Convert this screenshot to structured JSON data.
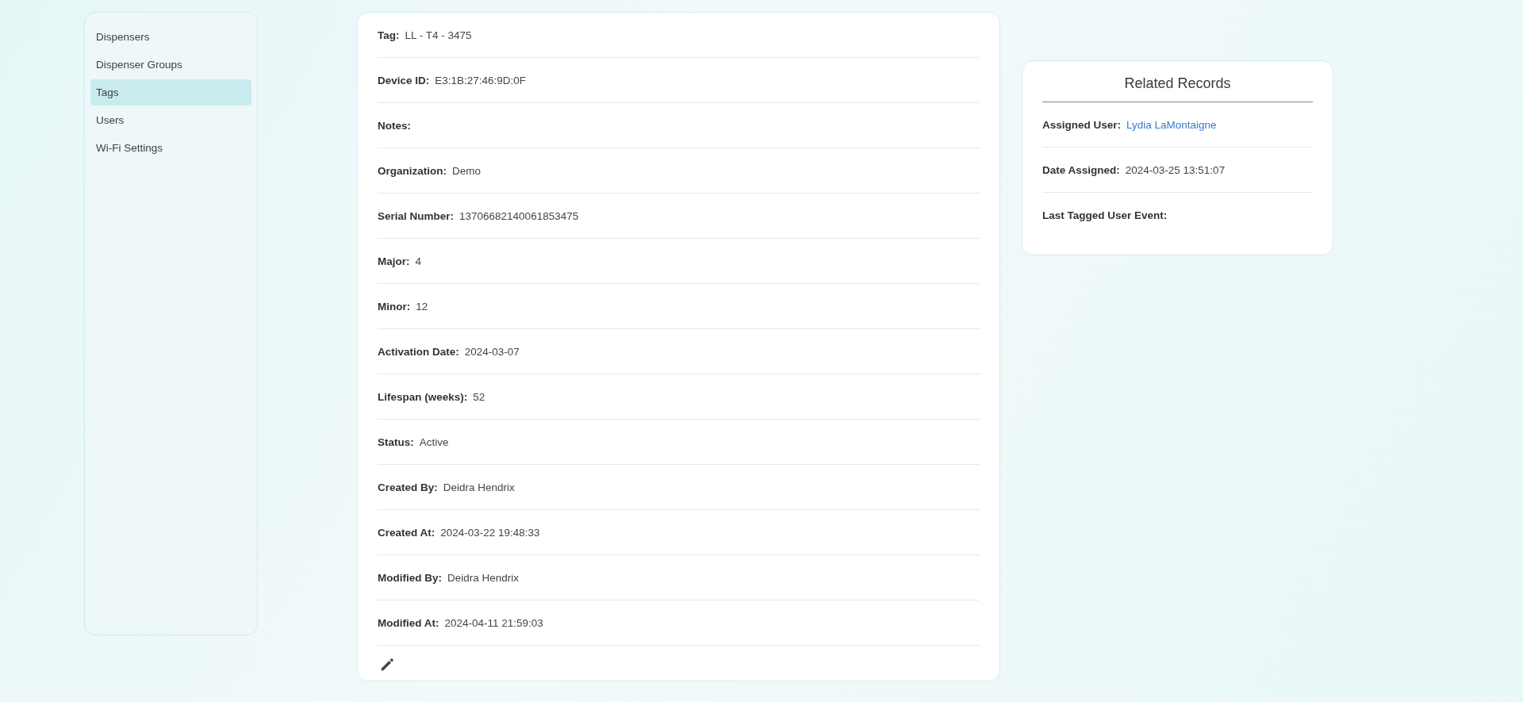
{
  "sidebar": {
    "items": [
      {
        "label": "Dispensers",
        "selected": false
      },
      {
        "label": "Dispenser Groups",
        "selected": false
      },
      {
        "label": "Tags",
        "selected": true
      },
      {
        "label": "Users",
        "selected": false
      },
      {
        "label": "Wi-Fi Settings",
        "selected": false
      }
    ]
  },
  "details": {
    "fields": [
      {
        "label": "Tag:",
        "value": "LL - T4 - 3475"
      },
      {
        "label": "Device ID:",
        "value": "E3:1B:27:46:9D:0F"
      },
      {
        "label": "Notes:"
      },
      {
        "label": "Organization:",
        "value": "Demo"
      },
      {
        "label": "Serial Number:",
        "value": "13706682140061853475"
      },
      {
        "label": "Major:",
        "value": "4"
      },
      {
        "label": "Minor:",
        "value": "12"
      },
      {
        "label": "Activation Date:",
        "value": "2024-03-07"
      },
      {
        "label": "Lifespan (weeks):",
        "value": "52"
      },
      {
        "label": "Status:",
        "value": "Active"
      },
      {
        "label": "Created By:",
        "value": "Deidra Hendrix"
      },
      {
        "label": "Created At:",
        "value": "2024-03-22 19:48:33"
      },
      {
        "label": "Modified By:",
        "value": "Deidra Hendrix"
      },
      {
        "label": "Modified At:",
        "value": "2024-04-11 21:59:03"
      }
    ]
  },
  "related_records": {
    "title": "Related Records",
    "fields": [
      {
        "label": "Assigned User:",
        "value": "Lydia LaMontaigne",
        "kind": "link"
      },
      {
        "label": "Date Assigned:",
        "value": "2024-03-25 13:51:07",
        "kind": "text"
      },
      {
        "label": "Last Tagged User Event:",
        "kind": "text"
      }
    ]
  }
}
